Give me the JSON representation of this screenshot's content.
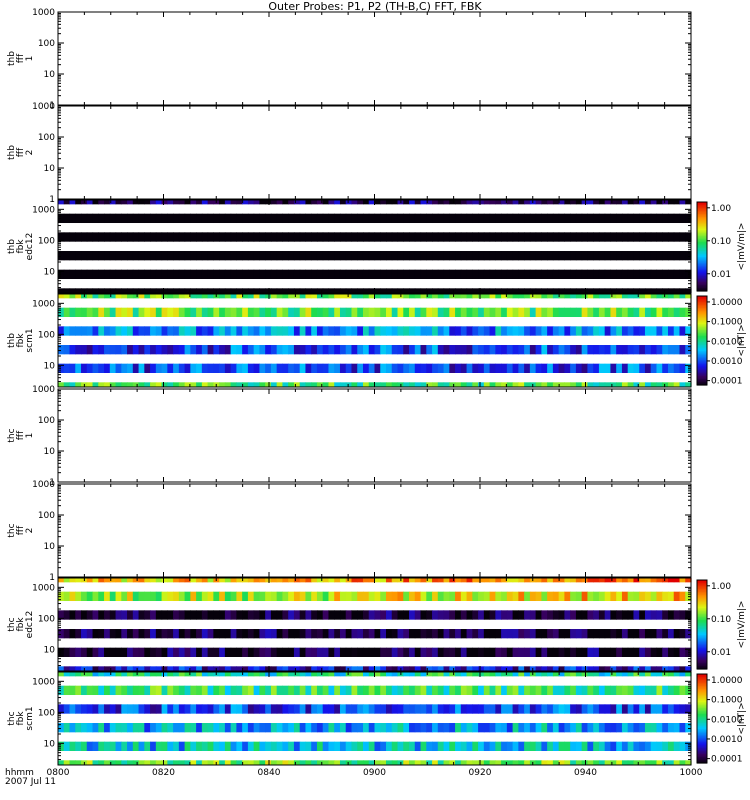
{
  "title": "Outer Probes: P1, P2 (TH-B,C) FFT, FBK",
  "x_axis": {
    "tick_labels": [
      "0800",
      "0820",
      "0840",
      "0900",
      "0920",
      "0940",
      "1000"
    ],
    "row_label": "hhmm",
    "date_label": "2007 Jul 11"
  },
  "chart_data": [
    {
      "type": "heatmap",
      "panel_label": [
        "thb",
        "fff",
        "1"
      ],
      "y_scale": "log",
      "ylim": [
        1,
        1000
      ],
      "y_tick_labels": [
        "1",
        "10",
        "100",
        "1000"
      ],
      "empty": true
    },
    {
      "type": "heatmap",
      "panel_label": [
        "thb",
        "fff",
        "2"
      ],
      "y_scale": "log",
      "ylim": [
        1,
        1000
      ],
      "y_tick_labels": [
        "1",
        "10",
        "100",
        "1000"
      ],
      "empty": true
    },
    {
      "type": "heatmap",
      "panel_label": [
        "thb",
        "fbk",
        "edc12"
      ],
      "y_scale": "log",
      "ylim": [
        2,
        2000
      ],
      "y_tick_labels": [
        "10",
        "100",
        "1000"
      ],
      "x_range": [
        "0800",
        "1000"
      ],
      "bands": [
        {
          "freq_hz": 2048,
          "value": 0.005
        },
        {
          "freq_hz": 512,
          "value": 0.0001
        },
        {
          "freq_hz": 128,
          "value": 0.0001
        },
        {
          "freq_hz": 32,
          "value": 0.0001
        },
        {
          "freq_hz": 8,
          "value": 0.0001
        },
        {
          "freq_hz": 2,
          "value": 0.0001
        }
      ],
      "colorbar": {
        "label": "<|mV/m|>",
        "scale": "log",
        "range": [
          0.003,
          1.5
        ],
        "tick_labels": [
          "0.01",
          "0.10",
          "1.00"
        ],
        "tick_values": [
          0.01,
          0.1,
          1.0
        ]
      }
    },
    {
      "type": "heatmap",
      "panel_label": [
        "thb",
        "fbk",
        "scm1"
      ],
      "y_scale": "log",
      "ylim": [
        2,
        2000
      ],
      "y_tick_labels": [
        "10",
        "100",
        "1000"
      ],
      "x_range": [
        "0800",
        "1000"
      ],
      "bands": [
        {
          "freq_hz": 2048,
          "value": 0.03
        },
        {
          "freq_hz": 512,
          "value": 0.03
        },
        {
          "freq_hz": 128,
          "value": 0.002
        },
        {
          "freq_hz": 32,
          "value": 0.001
        },
        {
          "freq_hz": 8,
          "value": 0.001
        },
        {
          "freq_hz": 2,
          "value": 0.02
        }
      ],
      "colorbar": {
        "label": "<|nT|>",
        "scale": "log",
        "range": [
          6e-05,
          2.0
        ],
        "tick_labels": [
          "0.0001",
          "0.0010",
          "0.0100",
          "0.1000",
          "1.0000"
        ],
        "tick_values": [
          0.0001,
          0.001,
          0.01,
          0.1,
          1.0
        ]
      }
    },
    {
      "type": "heatmap",
      "panel_label": [
        "thc",
        "fff",
        "1"
      ],
      "y_scale": "log",
      "ylim": [
        1,
        1000
      ],
      "y_tick_labels": [
        "1",
        "10",
        "100",
        "1000"
      ],
      "empty": true
    },
    {
      "type": "heatmap",
      "panel_label": [
        "thc",
        "fff",
        "2"
      ],
      "y_scale": "log",
      "ylim": [
        1,
        1000
      ],
      "y_tick_labels": [
        "1",
        "10",
        "100",
        "1000"
      ],
      "empty": true
    },
    {
      "type": "heatmap",
      "panel_label": [
        "thc",
        "fbk",
        "edc12"
      ],
      "y_scale": "log",
      "ylim": [
        2,
        2000
      ],
      "y_tick_labels": [
        "10",
        "100",
        "1000"
      ],
      "x_range": [
        "0800",
        "1000"
      ],
      "bands": [
        {
          "freq_hz": 2048,
          "value": 0.3
        },
        {
          "freq_hz": 512,
          "value": 0.15
        },
        {
          "freq_hz": 128,
          "value": 0.004
        },
        {
          "freq_hz": 32,
          "value": 0.004
        },
        {
          "freq_hz": 8,
          "value": 0.004
        },
        {
          "freq_hz": 2,
          "value": 0.01
        }
      ],
      "colorbar": {
        "label": "<|mV/m|>",
        "scale": "log",
        "range": [
          0.003,
          1.5
        ],
        "tick_labels": [
          "0.01",
          "0.10",
          "1.00"
        ],
        "tick_values": [
          0.01,
          0.1,
          1.0
        ]
      }
    },
    {
      "type": "heatmap",
      "panel_label": [
        "thc",
        "fbk",
        "scm1"
      ],
      "y_scale": "log",
      "ylim": [
        2,
        2000
      ],
      "y_tick_labels": [
        "10",
        "100",
        "1000"
      ],
      "x_range": [
        "0800",
        "1000"
      ],
      "bands": [
        {
          "freq_hz": 2048,
          "value": 0.01
        },
        {
          "freq_hz": 512,
          "value": 0.015
        },
        {
          "freq_hz": 128,
          "value": 0.001
        },
        {
          "freq_hz": 32,
          "value": 0.003
        },
        {
          "freq_hz": 8,
          "value": 0.004
        },
        {
          "freq_hz": 2,
          "value": 0.03
        }
      ],
      "colorbar": {
        "label": "<|nT|>",
        "scale": "log",
        "range": [
          6e-05,
          2.0
        ],
        "tick_labels": [
          "0.0001",
          "0.0010",
          "0.0100",
          "0.1000",
          "1.0000"
        ],
        "tick_values": [
          0.0001,
          0.001,
          0.01,
          0.1,
          1.0
        ]
      }
    }
  ]
}
